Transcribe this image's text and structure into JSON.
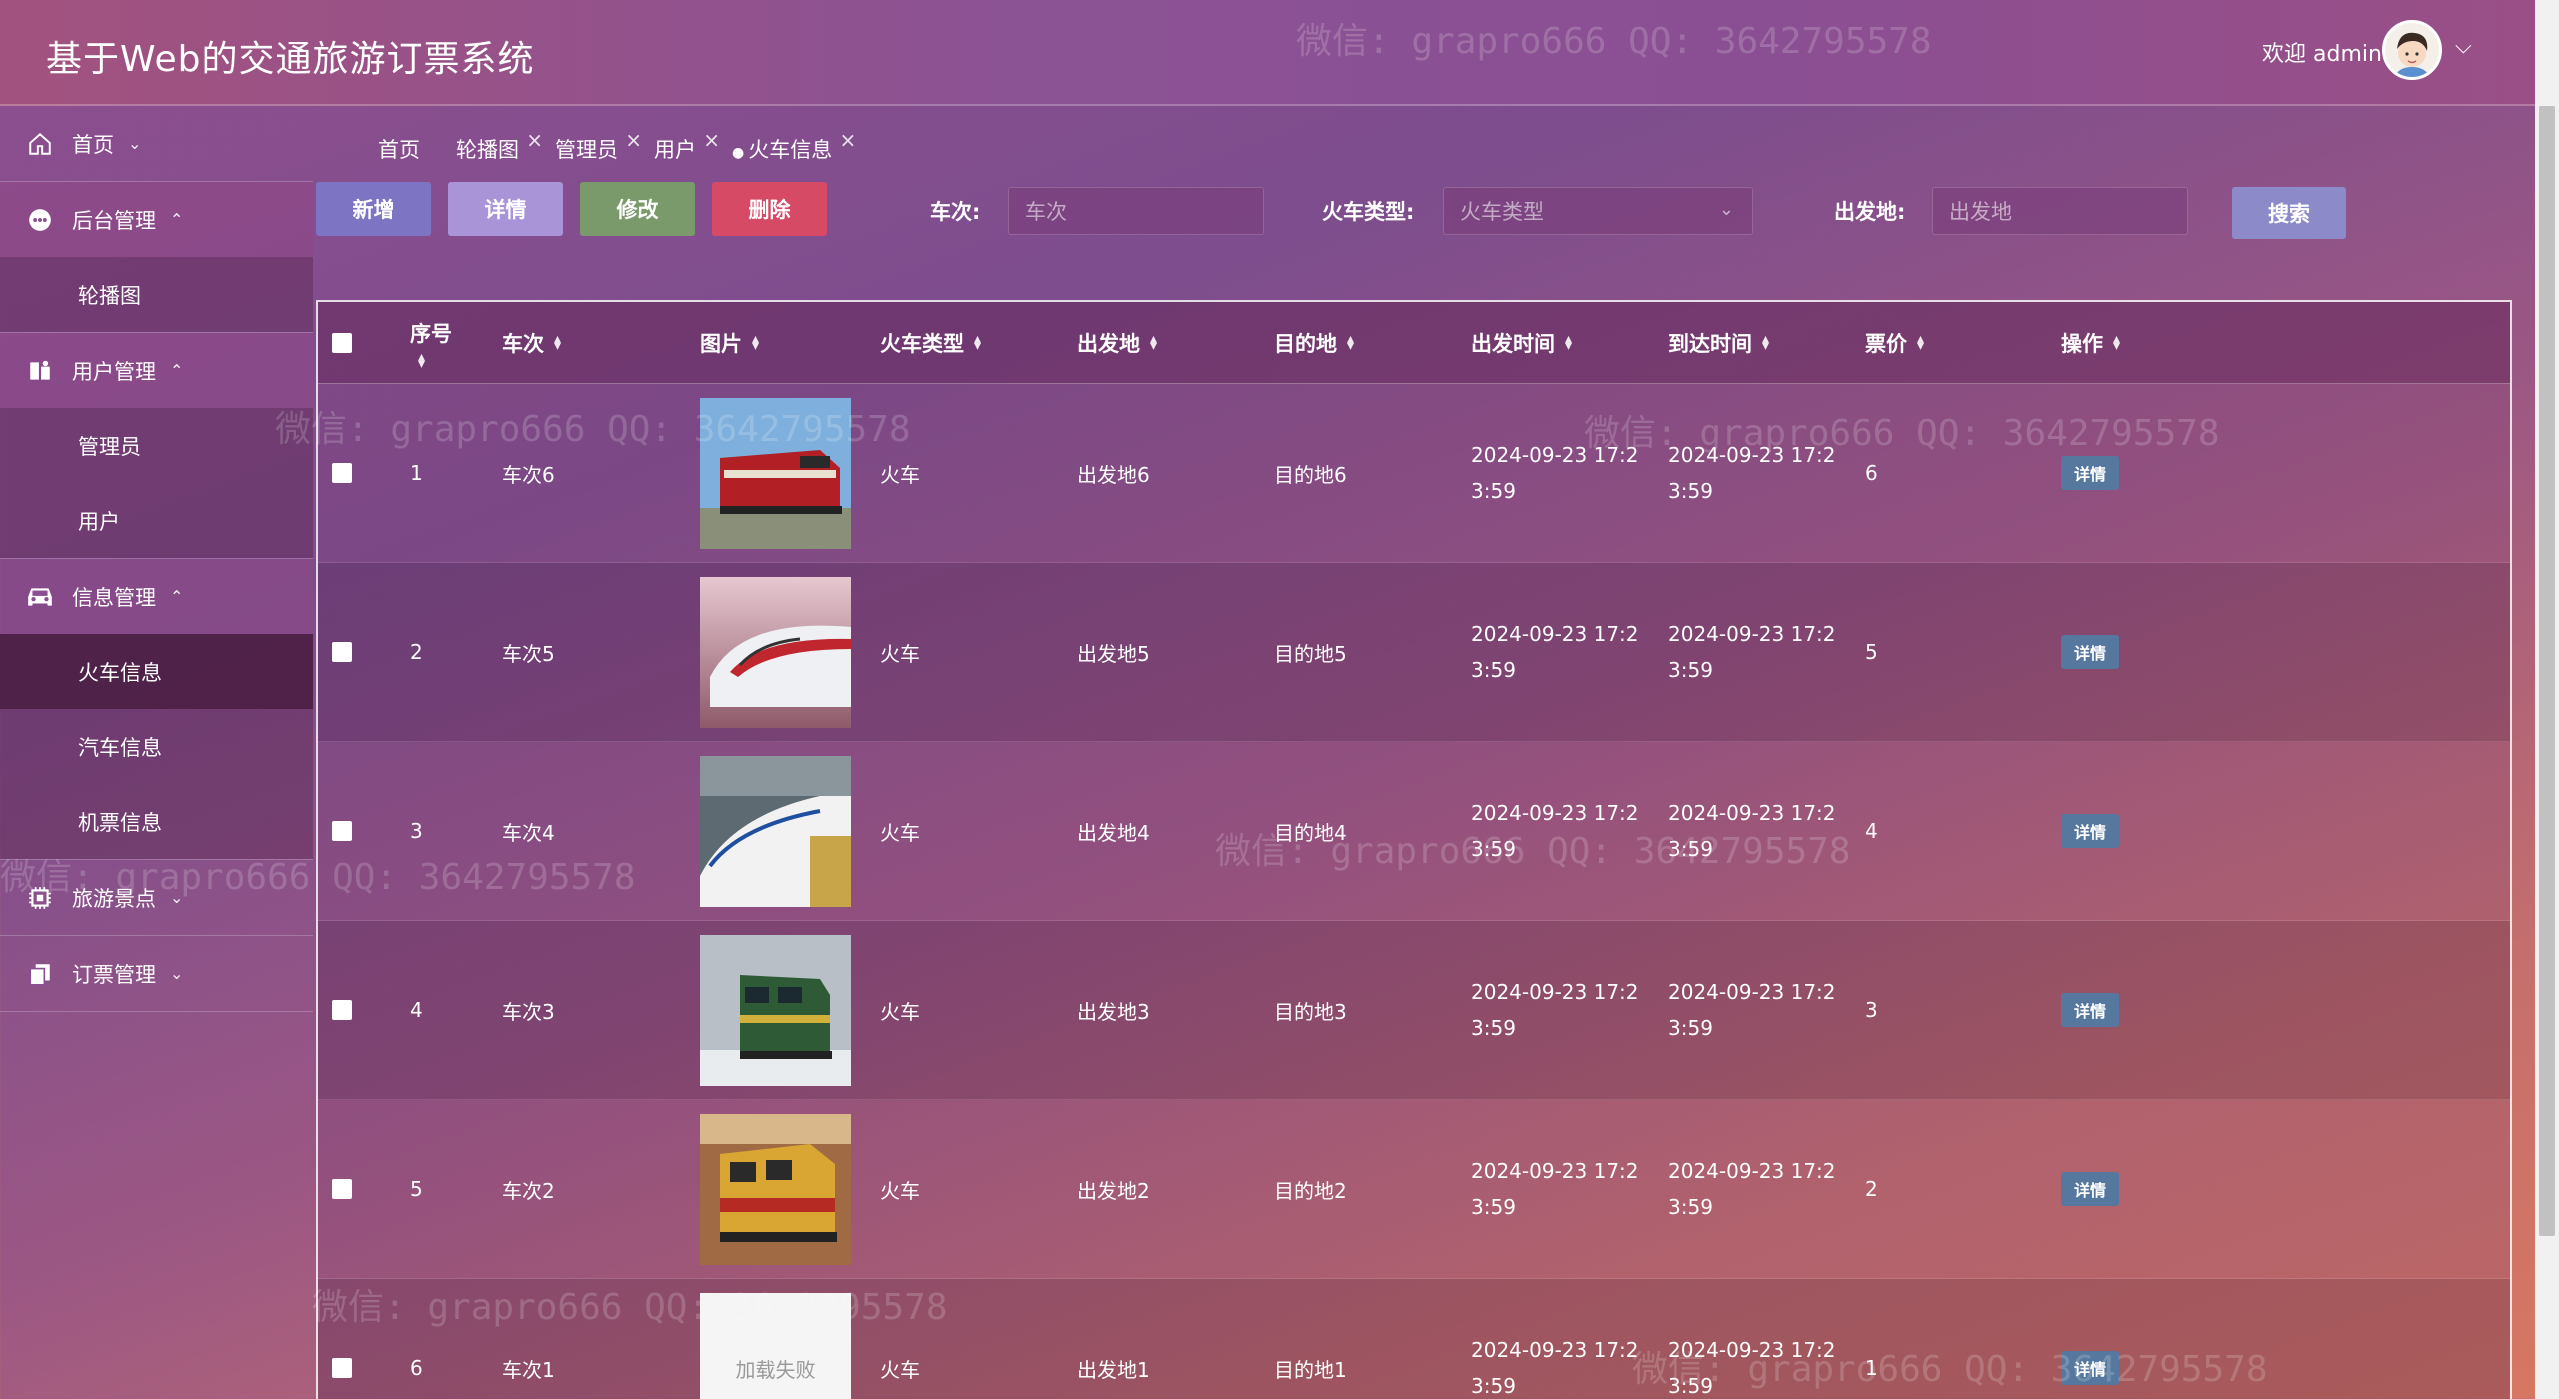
{
  "header": {
    "title": "基于Web的交通旅游订票系统",
    "welcome": "欢迎 admin"
  },
  "sidebar": {
    "groups": [
      {
        "label": "首页",
        "icon": "home-icon",
        "expanded": false,
        "items": []
      },
      {
        "label": "后台管理",
        "icon": "dashboard-icon",
        "expanded": true,
        "items": [
          "轮播图"
        ]
      },
      {
        "label": "用户管理",
        "icon": "user-folder-icon",
        "expanded": true,
        "items": [
          "管理员",
          "用户"
        ]
      },
      {
        "label": "信息管理",
        "icon": "car-icon",
        "expanded": true,
        "items": [
          "火车信息",
          "汽车信息",
          "机票信息"
        ]
      },
      {
        "label": "旅游景点",
        "icon": "chip-icon",
        "expanded": false,
        "items": []
      },
      {
        "label": "订票管理",
        "icon": "copy-icon",
        "expanded": false,
        "items": []
      }
    ],
    "active_item": "火车信息"
  },
  "tabs": [
    "首页",
    "轮播图",
    "管理员",
    "用户",
    "火车信息"
  ],
  "active_tab": "火车信息",
  "toolbar": {
    "add": "新增",
    "detail": "详情",
    "edit": "修改",
    "delete": "删除",
    "search": "搜索"
  },
  "filters": {
    "train_no_label": "车次:",
    "train_no_placeholder": "车次",
    "train_type_label": "火车类型:",
    "train_type_placeholder": "火车类型",
    "origin_label": "出发地:",
    "origin_placeholder": "出发地"
  },
  "table": {
    "headers": [
      "序号",
      "车次",
      "图片",
      "火车类型",
      "出发地",
      "目的地",
      "出发时间",
      "到达时间",
      "票价",
      "操作"
    ],
    "rows": [
      {
        "no": "1",
        "train": "车次6",
        "type": "火车",
        "from": "出发地6",
        "to": "目的地6",
        "dep1": "2024-09-23 17:2",
        "dep2": "3:59",
        "arr1": "2024-09-23 17:2",
        "arr2": "3:59",
        "price": "6",
        "op": "详情"
      },
      {
        "no": "2",
        "train": "车次5",
        "type": "火车",
        "from": "出发地5",
        "to": "目的地5",
        "dep1": "2024-09-23 17:2",
        "dep2": "3:59",
        "arr1": "2024-09-23 17:2",
        "arr2": "3:59",
        "price": "5",
        "op": "详情"
      },
      {
        "no": "3",
        "train": "车次4",
        "type": "火车",
        "from": "出发地4",
        "to": "目的地4",
        "dep1": "2024-09-23 17:2",
        "dep2": "3:59",
        "arr1": "2024-09-23 17:2",
        "arr2": "3:59",
        "price": "4",
        "op": "详情"
      },
      {
        "no": "4",
        "train": "车次3",
        "type": "火车",
        "from": "出发地3",
        "to": "目的地3",
        "dep1": "2024-09-23 17:2",
        "dep2": "3:59",
        "arr1": "2024-09-23 17:2",
        "arr2": "3:59",
        "price": "3",
        "op": "详情"
      },
      {
        "no": "5",
        "train": "车次2",
        "type": "火车",
        "from": "出发地2",
        "to": "目的地2",
        "dep1": "2024-09-23 17:2",
        "dep2": "3:59",
        "arr1": "2024-09-23 17:2",
        "arr2": "3:59",
        "price": "2",
        "op": "详情"
      },
      {
        "no": "6",
        "train": "车次1",
        "type": "火车",
        "from": "出发地1",
        "to": "目的地1",
        "dep1": "2024-09-23 17:2",
        "dep2": "3:59",
        "arr1": "2024-09-23 17:2",
        "arr2": "3:59",
        "price": "1",
        "op": "详情"
      }
    ],
    "image_failed_text": "加载失败"
  },
  "watermark": "微信: grapro666 QQ: 3642795578",
  "colors": {
    "add": "#7e74c4",
    "detail": "#a894d6",
    "edit": "#7a9a6c",
    "delete": "#d64a66",
    "search": "#8c8ac9",
    "row_detail": "#56789e"
  }
}
